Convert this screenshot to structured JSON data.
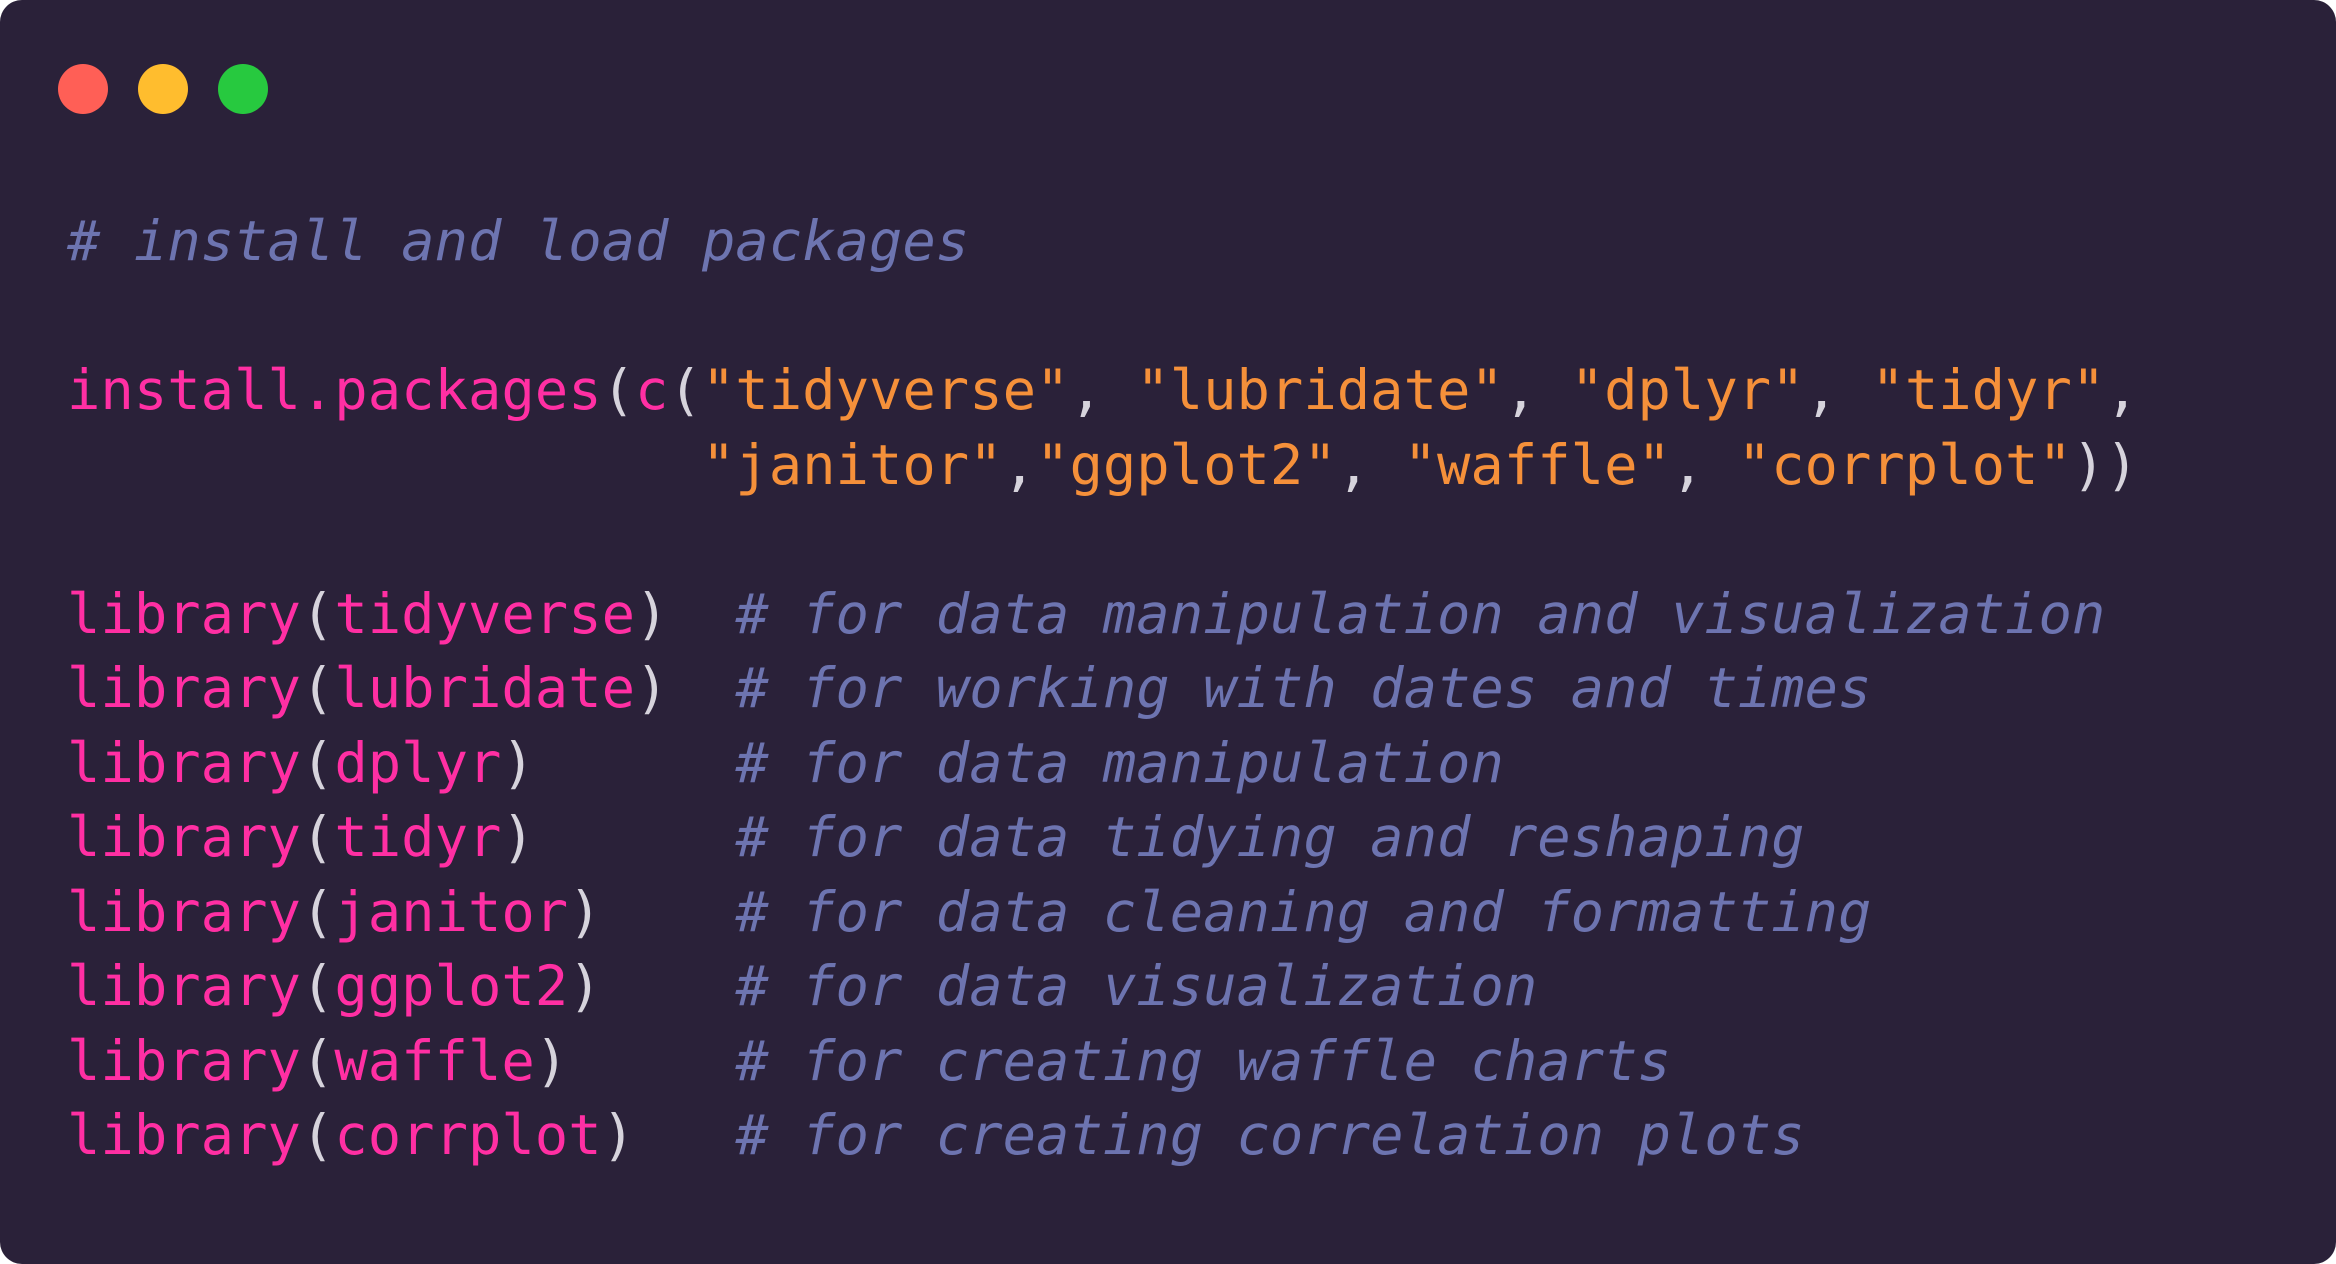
{
  "window": {
    "background": "#2a2139",
    "buttons": [
      {
        "name": "close",
        "color": "#ff5f56"
      },
      {
        "name": "minimize",
        "color": "#ffbd2e"
      },
      {
        "name": "maximize",
        "color": "#27c93f"
      }
    ]
  },
  "code": {
    "language": "R",
    "line1_comment": "# install and load packages",
    "install": {
      "fn": "install.packages",
      "open": "(",
      "c_fn": "c",
      "c_open": "(",
      "s1": "\"tidyverse\"",
      "sep1": ", ",
      "s2": "\"lubridate\"",
      "sep2": ", ",
      "s3": "\"dplyr\"",
      "sep3": ", ",
      "s4": "\"tidyr\"",
      "sep4": ",",
      "indent": "                   ",
      "s5": "\"janitor\"",
      "sep5": ",",
      "s6": "\"ggplot2\"",
      "sep6": ", ",
      "s7": "\"waffle\"",
      "sep7": ", ",
      "s8": "\"corrplot\"",
      "close": "))"
    },
    "library_lines": [
      {
        "fn": "library",
        "open": "(",
        "pkg": "tidyverse",
        "close": ")",
        "pad": "  ",
        "comment": "# for data manipulation and visualization"
      },
      {
        "fn": "library",
        "open": "(",
        "pkg": "lubridate",
        "close": ")",
        "pad": "  ",
        "comment": "# for working with dates and times"
      },
      {
        "fn": "library",
        "open": "(",
        "pkg": "dplyr",
        "close": ")",
        "pad": "      ",
        "comment": "# for data manipulation"
      },
      {
        "fn": "library",
        "open": "(",
        "pkg": "tidyr",
        "close": ")",
        "pad": "      ",
        "comment": "# for data tidying and reshaping"
      },
      {
        "fn": "library",
        "open": "(",
        "pkg": "janitor",
        "close": ")",
        "pad": "    ",
        "comment": "# for data cleaning and formatting"
      },
      {
        "fn": "library",
        "open": "(",
        "pkg": "ggplot2",
        "close": ")",
        "pad": "    ",
        "comment": "# for data visualization"
      },
      {
        "fn": "library",
        "open": "(",
        "pkg": "waffle",
        "close": ")",
        "pad": "     ",
        "comment": "# for creating waffle charts"
      },
      {
        "fn": "library",
        "open": "(",
        "pkg": "corrplot",
        "close": ")",
        "pad": "   ",
        "comment": "# for creating correlation plots"
      }
    ]
  }
}
